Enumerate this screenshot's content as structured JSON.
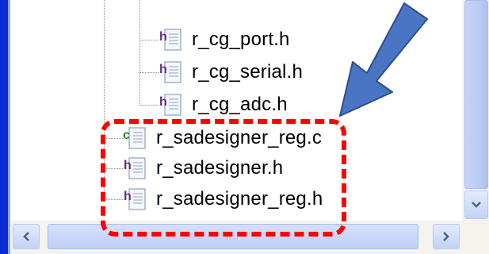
{
  "tree": {
    "items": [
      {
        "label": "r_cg_port.h",
        "type": "header"
      },
      {
        "label": "r_cg_serial.h",
        "type": "header"
      },
      {
        "label": "r_cg_adc.h",
        "type": "header"
      },
      {
        "label": "r_sadesigner_reg.c",
        "type": "source"
      },
      {
        "label": "r_sadesigner.h",
        "type": "header"
      },
      {
        "label": "r_sadesigner_reg.h",
        "type": "header"
      }
    ]
  },
  "icons": {
    "header": "h-file-icon",
    "source": "c-file-icon"
  },
  "colors": {
    "highlight": "#ff0000",
    "arrow_fill": "#4a74c4",
    "arrow_stroke": "#2e4f8c",
    "window_edge": "#0a2bd1",
    "scrollbar": "#c2d2f7"
  }
}
